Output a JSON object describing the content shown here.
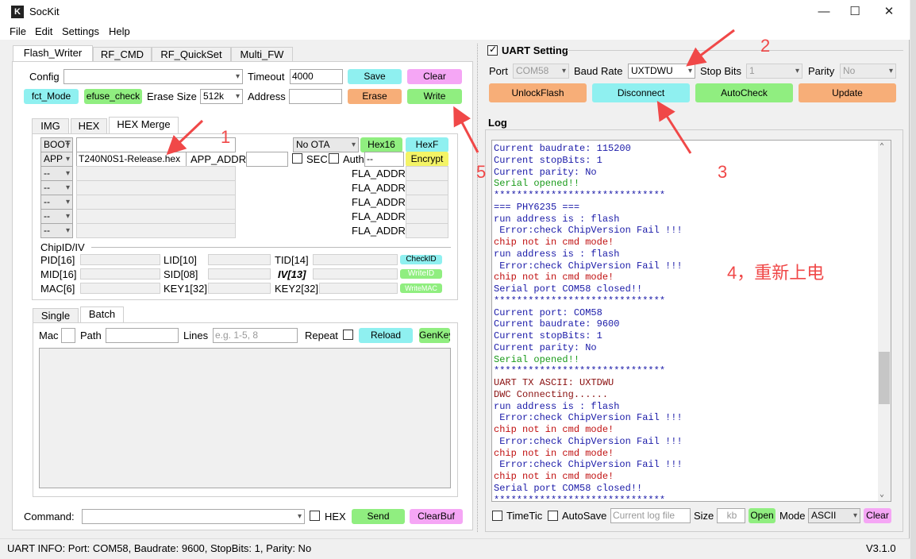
{
  "window": {
    "title": "SocKit",
    "version": "V3.1.0"
  },
  "menu": [
    "File",
    "Edit",
    "Settings",
    "Help"
  ],
  "main_tabs": [
    "Flash_Writer",
    "RF_CMD",
    "RF_QuickSet",
    "Multi_FW"
  ],
  "config": {
    "config_label": "Config",
    "config_value": "",
    "timeout_label": "Timeout",
    "timeout_value": "4000",
    "save": "Save",
    "clear": "Clear",
    "fct_mode": "fct_Mode",
    "efuse_check": "efuse_check",
    "erase_size_label": "Erase Size",
    "erase_size": "512k",
    "address_label": "Address",
    "address_value": "",
    "erase": "Erase",
    "write": "Write"
  },
  "sub_tabs": [
    "IMG",
    "HEX",
    "HEX Merge"
  ],
  "hex_merge": {
    "boot": "BOOT",
    "app": "APP",
    "app_file": "T240N0S1-Release.hex",
    "app_addr_label": "APP_ADDR",
    "ota": "No OTA",
    "hex16": "Hex16",
    "hexf": "HexF",
    "sec": "SEC",
    "auth": "Auth",
    "auth_value": "--",
    "encrypt": "Encrypt",
    "empty_combo": "--",
    "fla_addr": "FLA_ADDR"
  },
  "chipid": {
    "title": "ChipID/IV",
    "pid": "PID[16]",
    "lid": "LID[10]",
    "tid": "TID[14]",
    "checkid": "CheckID",
    "mid": "MID[16]",
    "sid": "SID[08]",
    "iv": "IV[13]",
    "writeid": "WriteID",
    "mac": "MAC[6]",
    "key1": "KEY1[32]",
    "key2": "KEY2[32]",
    "writemac": "WriteMAC"
  },
  "batch_tabs": [
    "Single",
    "Batch"
  ],
  "batch": {
    "mac": "Mac",
    "path": "Path",
    "lines": "Lines",
    "lines_placeholder": "e.g. 1-5, 8",
    "repeat": "Repeat",
    "reload": "Reload",
    "genkey": "GenKey"
  },
  "command": {
    "label": "Command:",
    "hex": "HEX",
    "send": "Send",
    "clearbuf": "ClearBuf"
  },
  "uart": {
    "title": "UART Setting",
    "port_label": "Port",
    "port": "COM58",
    "baud_label": "Baud Rate",
    "baud": "UXTDWU",
    "stop_label": "Stop Bits",
    "stop": "1",
    "parity_label": "Parity",
    "parity": "No",
    "unlock": "UnlockFlash",
    "disconnect": "Disconnect",
    "autocheck": "AutoCheck",
    "update": "Update"
  },
  "log": {
    "title": "Log",
    "lines": [
      {
        "t": "Current baudrate: 115200",
        "c": "#1a1aa8"
      },
      {
        "t": "Current stopBits: 1",
        "c": "#1a1aa8"
      },
      {
        "t": "Current parity: No",
        "c": "#1a1aa8"
      },
      {
        "t": "Serial opened!!",
        "c": "#1a9a1a"
      },
      {
        "t": "******************************",
        "c": "#1a1aa8"
      },
      {
        "t": "=== PHY6235 ===",
        "c": "#1a1aa8"
      },
      {
        "t": "run address is : flash",
        "c": "#1a1aa8"
      },
      {
        "t": " Error:check ChipVersion Fail !!!",
        "c": "#1a1aa8"
      },
      {
        "t": "chip not in cmd mode!",
        "c": "#c01010"
      },
      {
        "t": "run address is : flash",
        "c": "#1a1aa8"
      },
      {
        "t": " Error:check ChipVersion Fail !!!",
        "c": "#1a1aa8"
      },
      {
        "t": "chip not in cmd mode!",
        "c": "#c01010"
      },
      {
        "t": "Serial port COM58 closed!!",
        "c": "#1a1aa8"
      },
      {
        "t": "******************************",
        "c": "#1a1aa8"
      },
      {
        "t": "Current port: COM58",
        "c": "#1a1aa8"
      },
      {
        "t": "Current baudrate: 9600",
        "c": "#1a1aa8"
      },
      {
        "t": "Current stopBits: 1",
        "c": "#1a1aa8"
      },
      {
        "t": "Current parity: No",
        "c": "#1a1aa8"
      },
      {
        "t": "Serial opened!!",
        "c": "#1a9a1a"
      },
      {
        "t": "******************************",
        "c": "#1a1aa8"
      },
      {
        "t": "UART TX ASCII: UXTDWU",
        "c": "#8a1010"
      },
      {
        "t": "DWC Connecting......",
        "c": "#8a1010"
      },
      {
        "t": "run address is : flash",
        "c": "#1a1aa8"
      },
      {
        "t": " Error:check ChipVersion Fail !!!",
        "c": "#1a1aa8"
      },
      {
        "t": "chip not in cmd mode!",
        "c": "#c01010"
      },
      {
        "t": " Error:check ChipVersion Fail !!!",
        "c": "#1a1aa8"
      },
      {
        "t": "chip not in cmd mode!",
        "c": "#c01010"
      },
      {
        "t": " Error:check ChipVersion Fail !!!",
        "c": "#1a1aa8"
      },
      {
        "t": "chip not in cmd mode!",
        "c": "#c01010"
      },
      {
        "t": "Serial port COM58 closed!!",
        "c": "#1a1aa8"
      },
      {
        "t": "******************************",
        "c": "#1a1aa8"
      }
    ],
    "timetic": "TimeTic",
    "autosave": "AutoSave",
    "log_file_placeholder": "Current log file",
    "size_label": "Size",
    "size_placeholder": "kb",
    "open": "Open",
    "mode_label": "Mode",
    "mode": "ASCII",
    "clear": "Clear"
  },
  "status": {
    "text": "UART INFO: Port: COM58, Baudrate: 9600, StopBits: 1, Parity: No"
  },
  "annotations": {
    "n1": "1",
    "n2": "2",
    "n3": "3",
    "n4": "4，重新上电",
    "n5": "5"
  },
  "colors": {
    "cyan": "#8ff0f0",
    "pink": "#f5a6f5",
    "green": "#90ee80",
    "orange": "#f7ae78",
    "annotation": "#f04848"
  }
}
